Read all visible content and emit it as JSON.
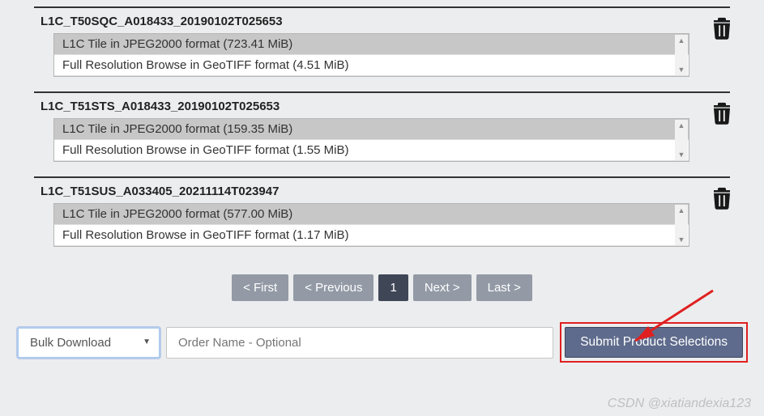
{
  "items": [
    {
      "title": "L1C_T50SQC_A018433_20190102T025653",
      "formats": [
        "L1C Tile in JPEG2000 format (723.41 MiB)",
        "Full Resolution Browse in GeoTIFF format (4.51 MiB)"
      ]
    },
    {
      "title": "L1C_T51STS_A018433_20190102T025653",
      "formats": [
        "L1C Tile in JPEG2000 format (159.35 MiB)",
        "Full Resolution Browse in GeoTIFF format (1.55 MiB)"
      ]
    },
    {
      "title": "L1C_T51SUS_A033405_20211114T023947",
      "formats": [
        "L1C Tile in JPEG2000 format (577.00 MiB)",
        "Full Resolution Browse in GeoTIFF format (1.17 MiB)"
      ]
    }
  ],
  "pagination": {
    "first": "< First",
    "previous": "< Previous",
    "current": "1",
    "next": "Next >",
    "last": "Last >"
  },
  "controls": {
    "bulk_label": "Bulk Download",
    "order_placeholder": "Order Name - Optional",
    "submit_label": "Submit Product Selections"
  },
  "watermark": "CSDN @xiatiandexia123"
}
